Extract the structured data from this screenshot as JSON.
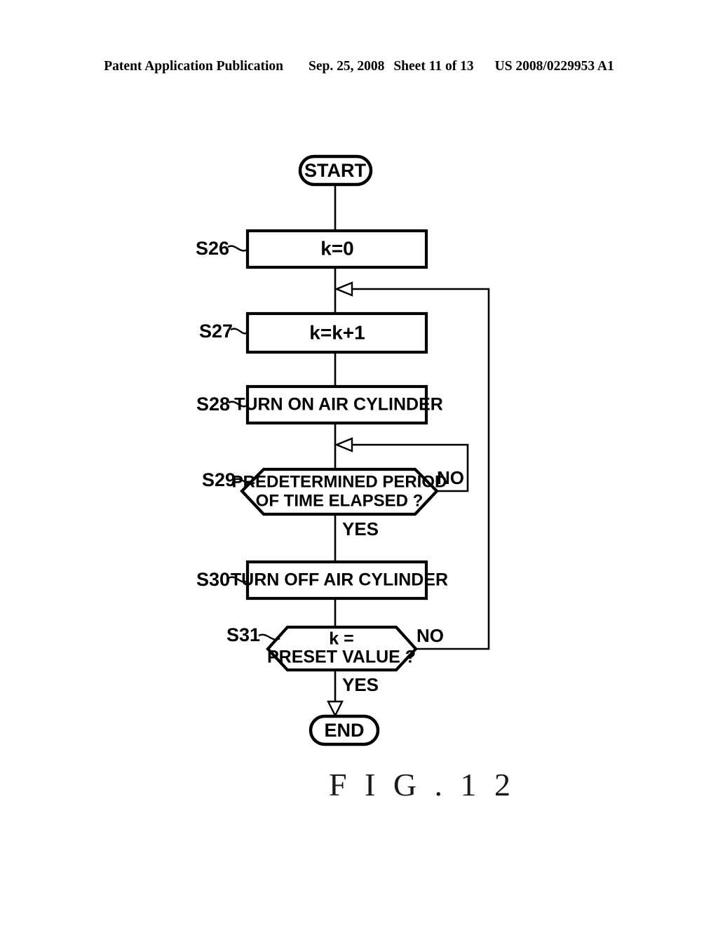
{
  "header": {
    "publication": "Patent Application Publication",
    "date": "Sep. 25, 2008",
    "sheet": "Sheet 11 of 13",
    "patent_number": "US 2008/0229953 A1"
  },
  "figure": {
    "caption": "F I G . 1 2"
  },
  "flowchart": {
    "start_label": "START",
    "end_label": "END",
    "yes_label_1": "YES",
    "yes_label_2": "YES",
    "no_label_1": "NO",
    "no_label_2": "NO",
    "steps": [
      {
        "id": "S26",
        "tag": "S26",
        "text": "k=0",
        "shape": "process"
      },
      {
        "id": "S27",
        "tag": "S27",
        "text": "k=k+1",
        "shape": "process"
      },
      {
        "id": "S28",
        "tag": "S28",
        "text": "TURN ON AIR CYLINDER",
        "shape": "process"
      },
      {
        "id": "S29",
        "tag": "S29",
        "text_line1": "PREDETERMINED PERIOD",
        "text_line2": "OF TIME ELAPSED ?",
        "shape": "decision"
      },
      {
        "id": "S30",
        "tag": "S30",
        "text": "TURN OFF AIR CYLINDER",
        "shape": "process"
      },
      {
        "id": "S31",
        "tag": "S31",
        "text_line1": "k =",
        "text_line2": "PRESET VALUE ?",
        "shape": "decision"
      }
    ]
  },
  "colors": {
    "ink": "#000000",
    "paper": "#ffffff"
  }
}
